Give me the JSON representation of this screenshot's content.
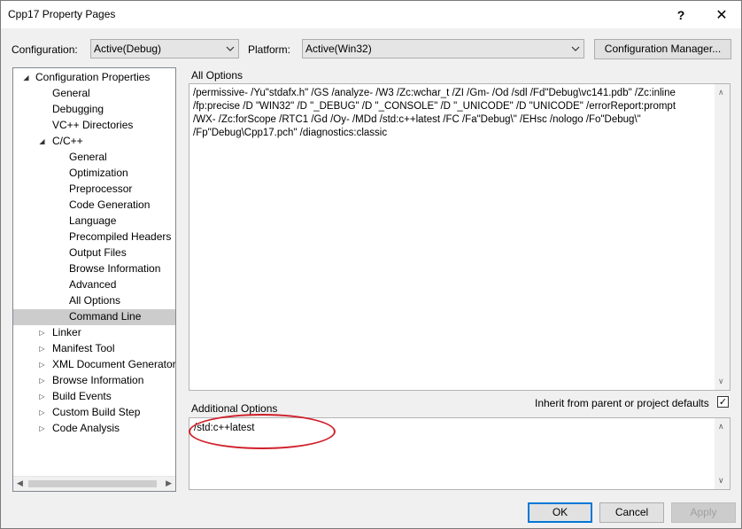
{
  "window": {
    "title": "Cpp17 Property Pages",
    "help_glyph": "?",
    "close_glyph": "✕"
  },
  "toolbar": {
    "configuration_label": "Configuration:",
    "configuration_value": "Active(Debug)",
    "platform_label": "Platform:",
    "platform_value": "Active(Win32)",
    "config_manager_label": "Configuration Manager..."
  },
  "tree": {
    "items": [
      {
        "label": "Configuration Properties",
        "expander": "◢"
      },
      {
        "label": "General"
      },
      {
        "label": "Debugging"
      },
      {
        "label": "VC++ Directories"
      },
      {
        "label": "C/C++",
        "expander": "◢"
      },
      {
        "label": "General"
      },
      {
        "label": "Optimization"
      },
      {
        "label": "Preprocessor"
      },
      {
        "label": "Code Generation"
      },
      {
        "label": "Language"
      },
      {
        "label": "Precompiled Headers"
      },
      {
        "label": "Output Files"
      },
      {
        "label": "Browse Information"
      },
      {
        "label": "Advanced"
      },
      {
        "label": "All Options"
      },
      {
        "label": "Command Line",
        "selected": true
      },
      {
        "label": "Linker",
        "expander": "▷"
      },
      {
        "label": "Manifest Tool",
        "expander": "▷"
      },
      {
        "label": "XML Document Generator",
        "expander": "▷"
      },
      {
        "label": "Browse Information",
        "expander": "▷"
      },
      {
        "label": "Build Events",
        "expander": "▷"
      },
      {
        "label": "Custom Build Step",
        "expander": "▷"
      },
      {
        "label": "Code Analysis",
        "expander": "▷"
      }
    ]
  },
  "all_options": {
    "label": "All Options",
    "lines": [
      "/permissive- /Yu\"stdafx.h\" /GS /analyze- /W3 /Zc:wchar_t /ZI /Gm- /Od /sdl /Fd\"Debug\\vc141.pdb\" /Zc:inline",
      "/fp:precise /D \"WIN32\" /D \"_DEBUG\" /D \"_CONSOLE\" /D \"_UNICODE\" /D \"UNICODE\" /errorReport:prompt",
      "/WX- /Zc:forScope /RTC1 /Gd /Oy- /MDd /std:c++latest /FC /Fa\"Debug\\\" /EHsc /nologo /Fo\"Debug\\\"",
      "/Fp\"Debug\\Cpp17.pch\" /diagnostics:classic"
    ]
  },
  "additional_options": {
    "label": "Additional Options",
    "value": "/std:c++latest",
    "inherit_label": "Inherit from parent or project defaults",
    "inherit_checked": true,
    "check_glyph": "✓"
  },
  "footer": {
    "ok_label": "OK",
    "cancel_label": "Cancel",
    "apply_label": "Apply"
  },
  "colors": {
    "annotation_circle": "#d0202a",
    "selection": "#cccccc",
    "default_button_border": "#0078d7"
  }
}
